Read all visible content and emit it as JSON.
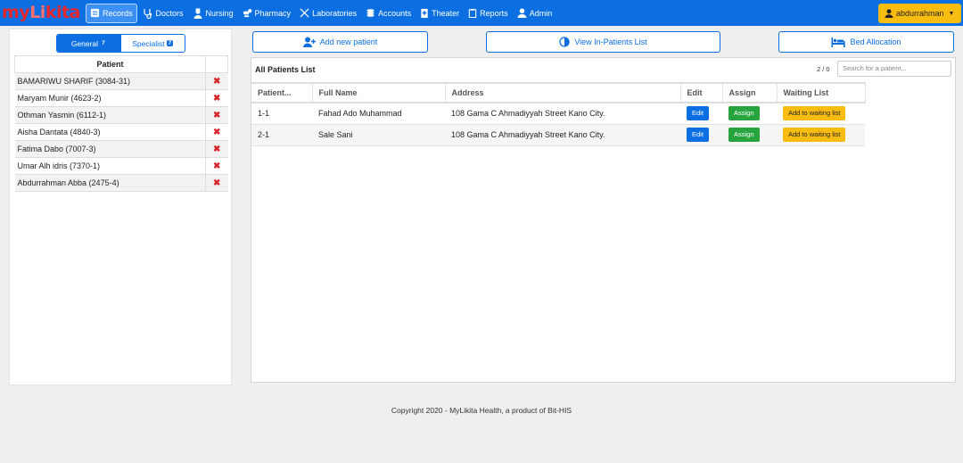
{
  "brand": {
    "logo_part1": "my",
    "logo_part2": "Li",
    "logo_part3": "kita"
  },
  "nav": {
    "items": [
      {
        "label": "Records",
        "icon": "records-icon",
        "active": true
      },
      {
        "label": "Doctors",
        "icon": "stethoscope-icon",
        "active": false
      },
      {
        "label": "Nursing",
        "icon": "nurse-icon",
        "active": false
      },
      {
        "label": "Pharmacy",
        "icon": "pills-icon",
        "active": false
      },
      {
        "label": "Laboratories",
        "icon": "lab-icon",
        "active": false
      },
      {
        "label": "Accounts",
        "icon": "coins-icon",
        "active": false
      },
      {
        "label": "Theater",
        "icon": "clinic-icon",
        "active": false
      },
      {
        "label": "Reports",
        "icon": "clipboard-icon",
        "active": false
      },
      {
        "label": "Admin",
        "icon": "user-icon",
        "active": false
      }
    ],
    "user": "abdurrahman"
  },
  "sidebar": {
    "toggle": [
      {
        "label": "General",
        "count": "7"
      },
      {
        "label": "Specialist",
        "count": "7"
      }
    ],
    "header": "Patient",
    "patients": [
      "BAMARIWU SHARIF (3084-31)",
      "Maryam Munir (4623-2)",
      "Othman Yasmin (6112-1)",
      "Aisha Dantata (4840-3)",
      "Fatima Dabo (7007-3)",
      "Umar Alh idris (7370-1)",
      "Abdurrahman Abba (2475-4)"
    ],
    "remove_glyph": "✖"
  },
  "actions": {
    "add_patient": "Add new patient",
    "view_inpatients": "View In-Patients List",
    "bed_allocation": "Bed Allocation"
  },
  "patients_list": {
    "title": "All Patients List",
    "pager": "2 / 0",
    "search_placeholder": "Search for a patient...",
    "columns": [
      "Patient...",
      "Full Name",
      "Address",
      "Edit",
      "Assign",
      "Waiting List"
    ],
    "rows": [
      {
        "id": "1-1",
        "name": "Fahad Ado Muhammad",
        "address": "108 Gama C Ahmadiyyah Street Kano City.",
        "edit": "Edit",
        "assign": "Assign",
        "waiting": "Add to waiting list"
      },
      {
        "id": "2-1",
        "name": "Sale Sani",
        "address": "108 Gama C Ahmadiyyah Street Kano City.",
        "edit": "Edit",
        "assign": "Assign",
        "waiting": "Add to waiting list"
      }
    ]
  },
  "footer": "Copyright 2020 - MyLikita Health, a product of Bit-HIS",
  "colors": {
    "primary": "#0b6fe1",
    "success": "#26a53f",
    "warning": "#f9bd12",
    "danger": "#d9262b"
  }
}
